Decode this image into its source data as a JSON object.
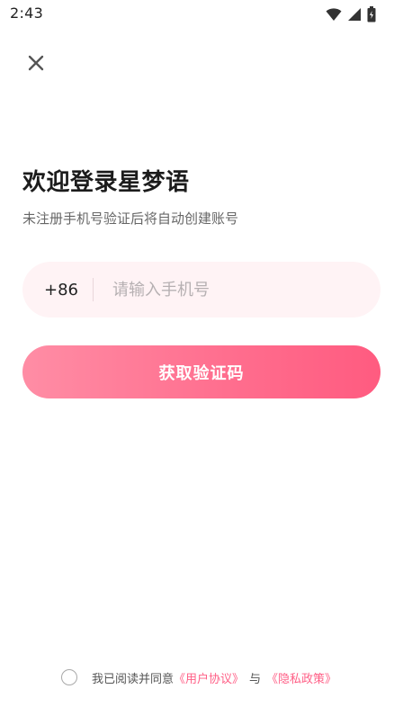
{
  "status_bar": {
    "time": "2:43",
    "icons": [
      "wifi-icon",
      "signal-icon",
      "battery-icon"
    ]
  },
  "header": {
    "close_icon": "close-icon"
  },
  "main": {
    "title": "欢迎登录星梦语",
    "subtitle": "未注册手机号验证后将自动创建账号",
    "phone": {
      "country_code": "+86",
      "placeholder": "请输入手机号",
      "value": ""
    },
    "get_code_label": "获取验证码"
  },
  "agreement": {
    "prefix": "我已阅读并同意",
    "user_agreement": "《用户协议》",
    "connector": "与",
    "privacy_policy": "《隐私政策》",
    "checked": false
  },
  "colors": {
    "accent": "#ff6f8f",
    "accent_light": "#fff3f5",
    "link": "#ff5f86"
  }
}
